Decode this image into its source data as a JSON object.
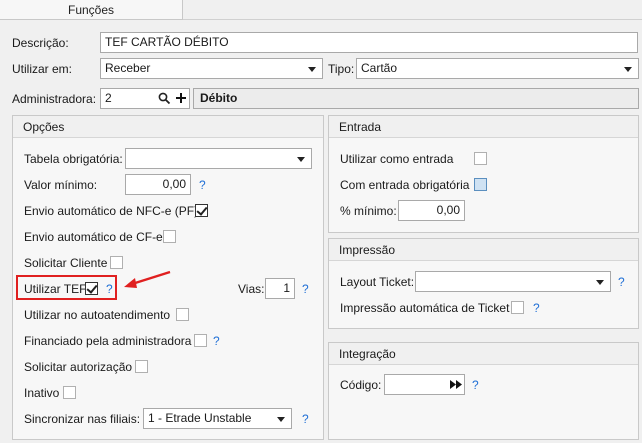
{
  "tab": {
    "label": "Funções"
  },
  "descricao": {
    "label": "Descrição:",
    "value": "TEF CARTÃO DÉBITO"
  },
  "utilizar_em": {
    "label": "Utilizar em:",
    "value": "Receber"
  },
  "tipo": {
    "label": "Tipo:",
    "value": "Cartão"
  },
  "administradora": {
    "label": "Administradora:",
    "code": "2",
    "name": "Débito"
  },
  "opcoes": {
    "title": "Opções",
    "tabela_obrigatoria": {
      "label": "Tabela obrigatória:",
      "value": ""
    },
    "valor_minimo": {
      "label": "Valor mínimo:",
      "value": "0,00"
    },
    "nfce": {
      "label": "Envio automático de NFC-e (PF)",
      "checked": true
    },
    "cfe": {
      "label": "Envio automático de CF-e",
      "checked": false
    },
    "solicitar_cliente": {
      "label": "Solicitar Cliente",
      "checked": false
    },
    "utilizar_tef": {
      "label": "Utilizar TEF",
      "checked": true
    },
    "vias": {
      "label": "Vias:",
      "value": "1"
    },
    "autoatendimento": {
      "label": "Utilizar no autoatendimento",
      "checked": false
    },
    "financiado": {
      "label": "Financiado pela administradora",
      "checked": false
    },
    "solicitar_autorizacao": {
      "label": "Solicitar autorização",
      "checked": false
    },
    "inativo": {
      "label": "Inativo",
      "checked": false
    },
    "sincronizar": {
      "label": "Sincronizar nas filiais:",
      "value": "1 - Etrade Unstable"
    }
  },
  "entrada": {
    "title": "Entrada",
    "utilizar_como_entrada": {
      "label": "Utilizar como entrada",
      "checked": false
    },
    "com_entrada_obrigatoria": {
      "label": "Com entrada obrigatória",
      "checked": false
    },
    "percentual_minimo": {
      "label": "% mínimo:",
      "value": "0,00"
    }
  },
  "impressao": {
    "title": "Impressão",
    "layout_ticket": {
      "label": "Layout Ticket:",
      "value": ""
    },
    "impressao_automatica": {
      "label": "Impressão automática de Ticket",
      "checked": false
    }
  },
  "integracao": {
    "title": "Integração",
    "codigo": {
      "label": "Código:",
      "value": ""
    }
  },
  "help_text": "?",
  "colors": {
    "highlight": "#e02020",
    "arrow": "#e02020",
    "help": "#1f6fd6"
  }
}
